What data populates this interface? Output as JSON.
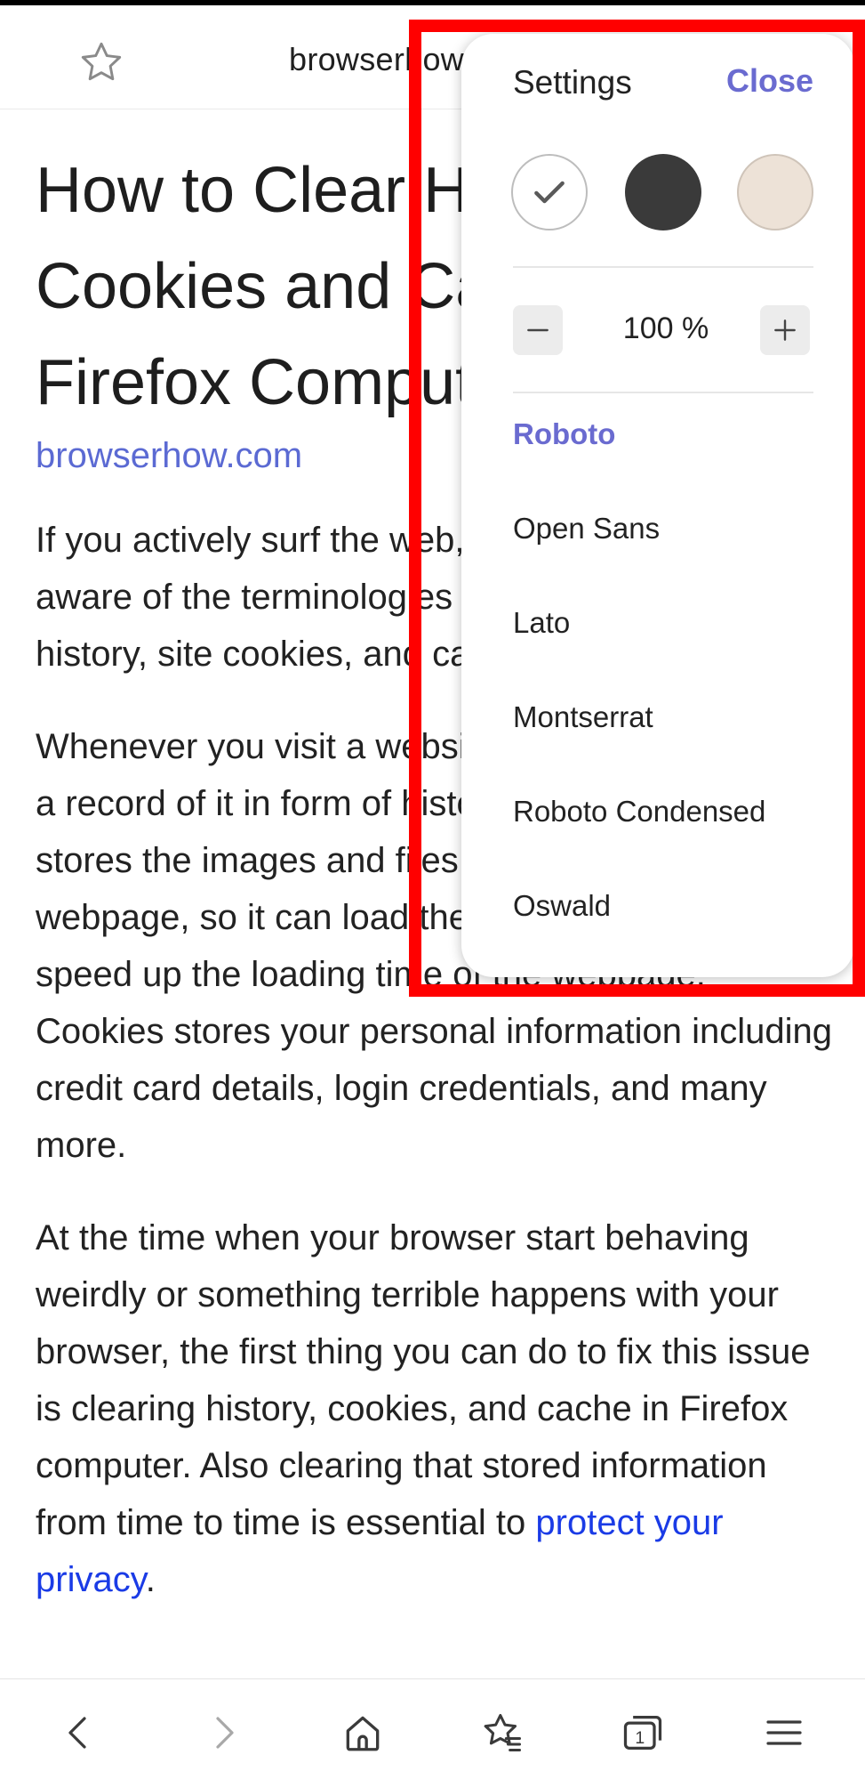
{
  "header": {
    "url": "browserhow.com"
  },
  "article": {
    "title_lines": [
      "How to Clear History,",
      "Cookies and Cache in",
      "Firefox Computer?"
    ],
    "source": "browserhow.com",
    "paragraphs": [
      "If you actively surf the web, then you must be aware of the terminologies such as browsing history, site cookies, and cache data.",
      "Whenever you visit a website, the browser keeps a record of it in form of history. The browser cache stores the images and files displayed on the webpage, so it can load them and use them to speed up the loading time of the webpage. Cookies stores your personal information including credit card details, login credentials, and many more.",
      "At the time when your browser start behaving weirdly or something terrible happens with your browser, the first thing you can do to fix this issue is clearing history, cookies, and cache in Firefox computer. Also clearing that stored information from time to time is essential to "
    ],
    "privacy_link": "protect your privacy",
    "privacy_tail": "."
  },
  "settings": {
    "title": "Settings",
    "close_label": "Close",
    "themes": [
      {
        "name": "light",
        "color": "#ffffff",
        "selected": true
      },
      {
        "name": "dark",
        "color": "#3a3a3a",
        "selected": false
      },
      {
        "name": "sepia",
        "color": "#ede2d7",
        "selected": false
      }
    ],
    "zoom": "100 %",
    "fonts": [
      {
        "label": "Roboto",
        "selected": true
      },
      {
        "label": "Open Sans",
        "selected": false
      },
      {
        "label": "Lato",
        "selected": false
      },
      {
        "label": "Montserrat",
        "selected": false
      },
      {
        "label": "Roboto Condensed",
        "selected": false
      },
      {
        "label": "Oswald",
        "selected": false
      }
    ]
  },
  "toolbar": {
    "tabs_count": "1"
  },
  "colors": {
    "accent": "#6a6bd0",
    "link": "#1a3be6",
    "source_link": "#5b6ad3",
    "highlight": "#ff0000"
  }
}
